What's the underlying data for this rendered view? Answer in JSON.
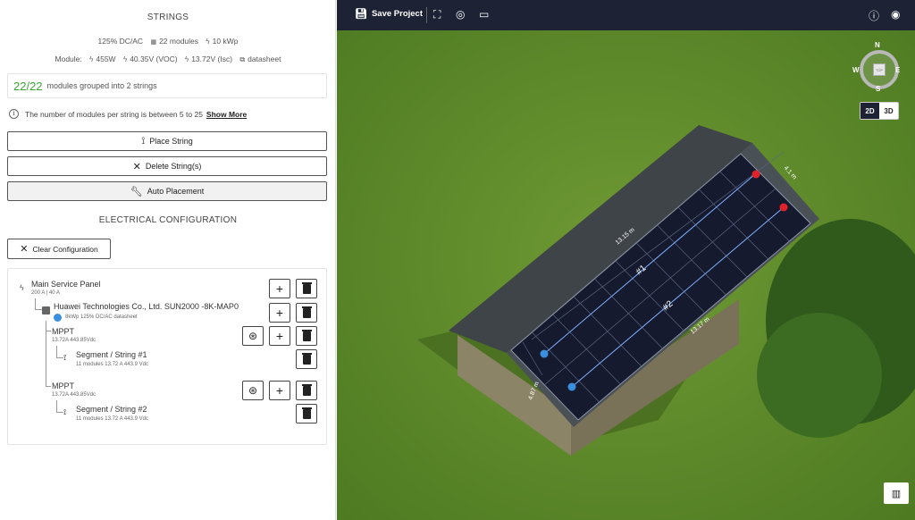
{
  "strings": {
    "title": "STRINGS",
    "dcac": "125% DC/AC",
    "modules": "22 modules",
    "power": "10 kWp",
    "module_label": "Module:",
    "module_watt": "455W",
    "module_voc": "40.35V (VOC)",
    "module_isc": "13.72V (Isc)",
    "datasheet": "datasheet",
    "summary_count": "22/22",
    "summary_text": "modules grouped into 2 strings",
    "info_text": "The number of modules per string is between 5 to 25",
    "show_more": "Show More",
    "place_string": "Place String",
    "delete_strings": "Delete String(s)",
    "auto_placement": "Auto Placement"
  },
  "electrical": {
    "title": "ELECTRICAL CONFIGURATION",
    "clear": "Clear Configuration",
    "panel_title": "Main Service Panel",
    "panel_sub": "200 A | 40 A",
    "inverter_title": "Huawei Technologies Co., Ltd. SUN2000 -8K-MAP0",
    "inverter_sub": "8kWp   125% DC/AC   datasheet",
    "mppt1_title": "MPPT",
    "mppt1_sub": "13.72A   443.85Vdc",
    "string1_title": "Segment / String #1",
    "string1_sub": "11 modules   13.72 A   443.9 Vdc",
    "mppt2_title": "MPPT",
    "mppt2_sub": "13.72A   443.85Vdc",
    "string2_title": "Segment / String #2",
    "string2_sub": "11 modules   13.72 A   443.9 Vdc"
  },
  "view": {
    "save_project": "Save Project",
    "compass_n": "N",
    "compass_s": "S",
    "compass_e": "E",
    "compass_w": "W",
    "compass_box": "TOP",
    "btn_2d": "2D",
    "btn_3d": "3D",
    "dim_top": "13.15 m",
    "dim_right": "4.1 m",
    "dim_bottom": "13.17 m",
    "dim_left": "4.87 m",
    "label_string1": "#1",
    "label_string2": "#2"
  },
  "colors": {
    "accent_green": "#3aa635",
    "topbar": "#1d2235",
    "grass": "#5e8a2a",
    "string_start": "#3a8fde",
    "string_end": "#e0232a"
  }
}
